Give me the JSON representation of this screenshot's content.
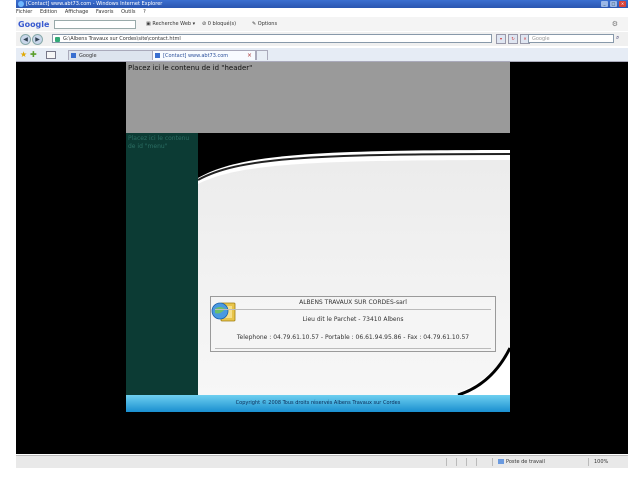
{
  "window": {
    "title": "[Contact] www.abt73.com - Windows Internet Explorer"
  },
  "menubar": {
    "items": [
      "Fichier",
      "Edition",
      "Affichage",
      "Favoris",
      "Outils",
      "?"
    ]
  },
  "google_toolbar": {
    "logo": "Google",
    "search_label": "Recherche Web",
    "blocked_label": "0 bloqué(s)",
    "options_label": "Options"
  },
  "address_bar": {
    "url": "G:\\Albens Travaux sur Cordes\\site\\contact.html",
    "search_placeholder": "Google"
  },
  "tabs": [
    {
      "label": "Google"
    },
    {
      "label": "[Contact] www.abt73.com"
    }
  ],
  "page": {
    "header_text": "Placez ici le contenu de id \"header\"",
    "menu_text": "Placez ici le contenu de id \"menu\"",
    "company_name": "ALBENS TRAVAUX SUR CORDES-sarl",
    "address": "Lieu dit le Parchet - 73410 Albens",
    "contact_line": "Telephone : 04.79.61.10.57 - Portable : 06.61.94.95.86 - Fax : 04.79.61.10.57",
    "footer_text": "Copyright © 2008 Tous droits réservés Albens Travaux sur Cordes"
  },
  "statusbar": {
    "zone": "Poste de travail",
    "zoom": "100%"
  },
  "colors": {
    "header_bg": "#9a9a9a",
    "menu_bg": "#0c3b34",
    "footer_bg": "#1a8fd0",
    "page_bg": "#000000"
  }
}
